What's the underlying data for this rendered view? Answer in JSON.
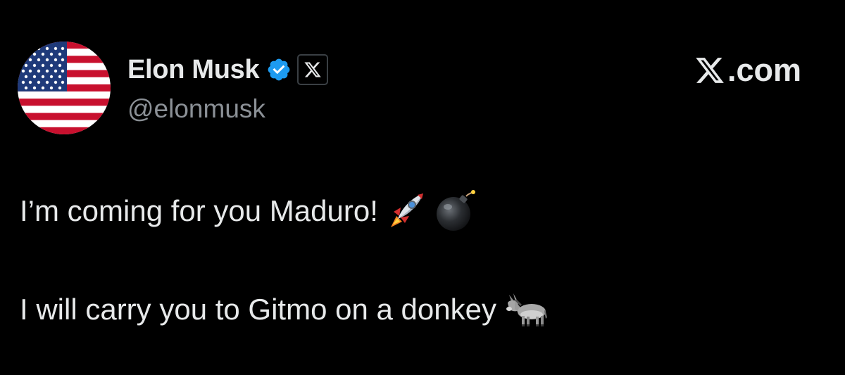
{
  "author": {
    "display_name": "Elon Musk",
    "handle": "@elonmusk",
    "verified": true,
    "affiliate_badge": "x-logo-icon",
    "avatar": "us-flag-avatar"
  },
  "brand": {
    "label": ".com",
    "icon": "x-logo-icon"
  },
  "tweet": {
    "line1": {
      "text": "I’m coming for you Maduro!",
      "emojis": [
        "rocket-emoji",
        "bomb-emoji"
      ]
    },
    "line2": {
      "text": "I will carry you to Gitmo on a donkey",
      "emojis": [
        "donkey-emoji"
      ]
    }
  },
  "colors": {
    "background": "#000000",
    "primary_text": "#e7e9ea",
    "secondary_text": "#8b9096",
    "verified_blue": "#1d9bf0"
  }
}
